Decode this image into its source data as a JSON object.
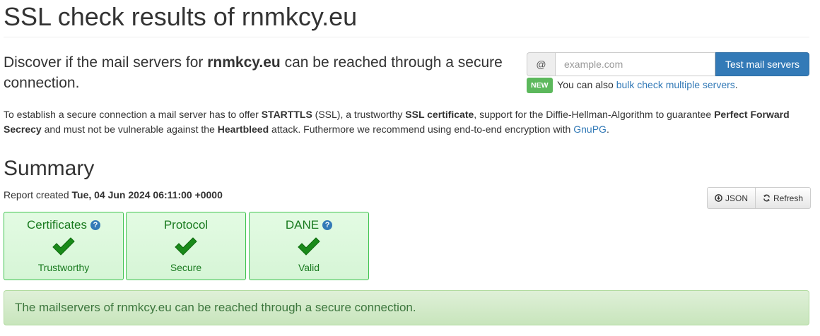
{
  "header": {
    "title": "SSL check results of rnmkcy.eu"
  },
  "intro": {
    "text_before": "Discover if the mail servers for ",
    "domain": "rnmkcy.eu",
    "text_after": " can be reached through a secure connection."
  },
  "search": {
    "addon": "@",
    "placeholder": "example.com",
    "value": "",
    "button_label": "Test mail servers"
  },
  "bulk": {
    "badge": "NEW",
    "text": "You can also ",
    "link": "bulk check multiple servers",
    "suffix": "."
  },
  "info": {
    "t1": "To establish a secure connection a mail server has to offer ",
    "b1": "STARTTLS",
    "t2": " (SSL), a trustworthy ",
    "b2": "SSL certificate",
    "t3": ", support for the Diffie-Hellman-Algorithm to guarantee ",
    "b3": "Perfect Forward Secrecy",
    "t4": " and must not be vulnerable against the ",
    "b4": "Heartbleed",
    "t5": " attack. Futhermore we recommend using end-to-end encryption with ",
    "link": "GnuPG",
    "t6": "."
  },
  "summary": {
    "title": "Summary",
    "report_prefix": "Report created ",
    "report_date": "Tue, 04 Jun 2024 06:11:00 +0000",
    "json_label": "JSON",
    "refresh_label": "Refresh",
    "cards": [
      {
        "title": "Certificates",
        "status": "Trustworthy",
        "help": "?",
        "icon": "check-icon"
      },
      {
        "title": "Protocol",
        "status": "Secure",
        "icon": "check-icon"
      },
      {
        "title": "DANE",
        "status": "Valid",
        "help": "?",
        "icon": "check-icon"
      }
    ],
    "alert": "The mailservers of rnmkcy.eu can be reached through a secure connection."
  },
  "colors": {
    "primary": "#337ab7",
    "success_border": "#3fc34f",
    "success_text": "#197a1f",
    "badge_green": "#5cb85c",
    "alert_text": "#3c763d"
  }
}
